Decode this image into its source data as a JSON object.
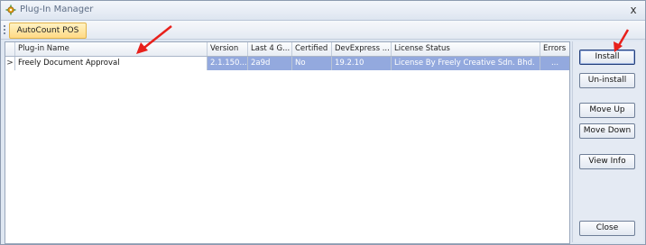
{
  "window": {
    "title": "Plug-In Manager",
    "close_glyph": "x",
    "icon": "plugin-gear-icon"
  },
  "toolbar": {
    "tab_label": "AutoCount POS"
  },
  "grid": {
    "columns": [
      "Plug-in Name",
      "Version",
      "Last 4 G...",
      "Certified",
      "DevExpress ...",
      "License Status",
      "Errors"
    ],
    "rows": [
      {
        "indicator": ">",
        "name": "Freely Document Approval",
        "version": "2.1.150...",
        "last4": "2a9d",
        "certified": "No",
        "devexpress": "19.2.10",
        "license": "License By Freely Creative Sdn. Bhd.",
        "errors": "..."
      }
    ]
  },
  "buttons": {
    "install": "Install",
    "uninstall": "Un-install",
    "move_up": "Move Up",
    "move_down": "Move Down",
    "view_info": "View Info",
    "close": "Close"
  },
  "colors": {
    "selection": "#93a9de",
    "annotation_arrow": "#e8201b",
    "tab_highlight": "#ffd985"
  }
}
